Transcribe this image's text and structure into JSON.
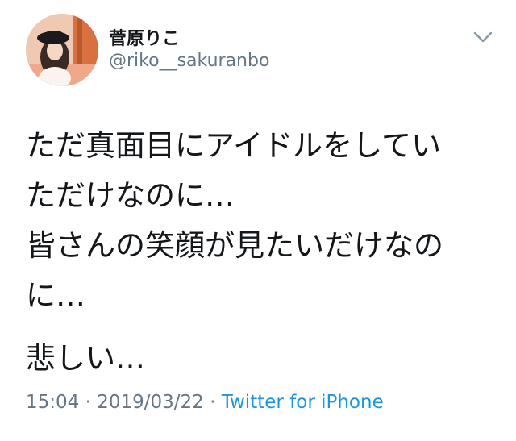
{
  "author": {
    "display_name": "菅原りこ",
    "handle": "@riko__sakuranbo"
  },
  "icons": {
    "avatar": "profile-photo",
    "menu": "chevron-down-icon"
  },
  "tweet": {
    "paragraphs": [
      [
        "ただ真面目にアイドルをしてい",
        "ただけなのに…",
        "皆さんの笑顔が見たいだけなの",
        "に…"
      ],
      [
        "悲しい…"
      ]
    ]
  },
  "meta": {
    "time": "15:04",
    "separator": " · ",
    "date": "2019/03/22",
    "source": "Twitter for iPhone"
  },
  "colors": {
    "text": "#14171a",
    "secondary": "#657786",
    "link": "#1b95e0"
  }
}
